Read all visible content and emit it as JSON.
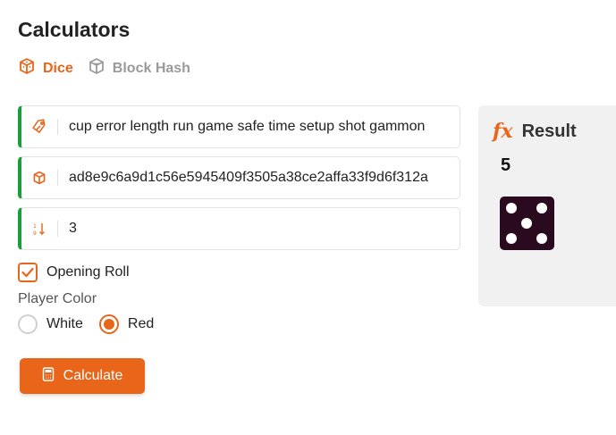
{
  "page": {
    "title": "Calculators"
  },
  "tabs": [
    {
      "label": "Dice",
      "icon": "cube-icon",
      "active": true
    },
    {
      "label": "Block Hash",
      "icon": "cube-outline-icon",
      "active": false
    }
  ],
  "form": {
    "seed_phrase": "cup error length run game safe time setup shot gammon",
    "hash": "ad8e9c6a9d1c56e5945409f3505a38ce2affa33f9d6f312a",
    "number": "3",
    "opening_roll": {
      "label": "Opening Roll",
      "checked": true
    },
    "player_color": {
      "label": "Player Color",
      "options": [
        "White",
        "Red"
      ],
      "selected": "Red"
    },
    "calculate_label": "Calculate"
  },
  "result": {
    "title": "Result",
    "value": "5",
    "die_face": 5
  },
  "colors": {
    "accent": "#e8651a",
    "field_border_left": "#1a9e3a",
    "die": "#2a0a1e"
  }
}
